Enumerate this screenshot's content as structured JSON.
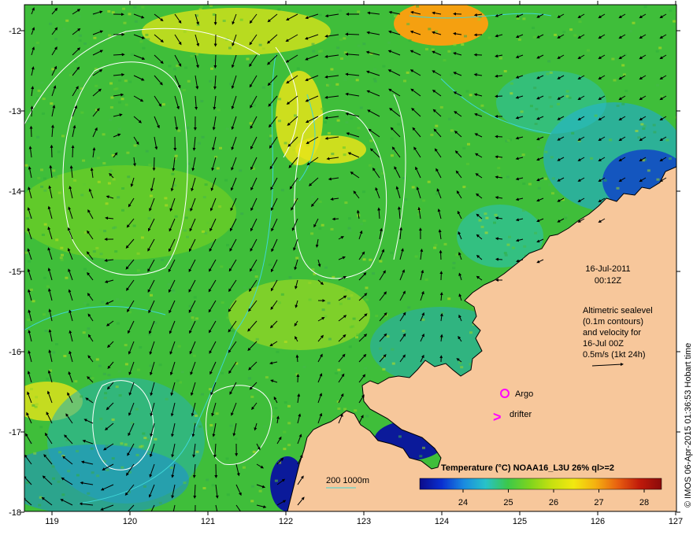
{
  "colors": {
    "land": "#f7c79b",
    "sst_warm": "#e9e417",
    "sst_mid": "#3fbe3a",
    "sst_cool": "#20a8d6",
    "sst_cold": "#0b1a9a",
    "contour": "#ffffff",
    "bathymetry": "#3fd6d6",
    "argo": "#ff00ff",
    "drifter": "#ff00ff"
  },
  "axes": {
    "x_ticks": [
      "119",
      "120",
      "121",
      "122",
      "123",
      "124",
      "125",
      "126",
      "127"
    ],
    "y_ticks": [
      "-12",
      "-13",
      "-14",
      "-15",
      "-16",
      "-17",
      "-18"
    ]
  },
  "annotations": {
    "date": "16-Jul-2011",
    "time": "00:12Z",
    "info_line1": "Altimetric sealevel",
    "info_line2": "(0.1m contours)",
    "info_line3": "and velocity for",
    "info_line4": "16-Jul 00Z",
    "scale_label": "0.5m/s (1kt 24h)",
    "argo_label": "Argo",
    "drifter_label": "drifter",
    "drifter_symbol": ">",
    "bathy_label": "200  1000m",
    "credit": "© IMOS 06-Apr-2015 01:36:53 Hobart time"
  },
  "legend": {
    "title": "Temperature (°C) NOAA16_L3U 26% ql>=2",
    "ticks": [
      "24",
      "25",
      "26",
      "27",
      "28"
    ],
    "colormap": [
      "#0b0b8a",
      "#0a2fd0",
      "#1a8ae0",
      "#28c2c8",
      "#3cc84a",
      "#7dd41e",
      "#c6e010",
      "#f2e810",
      "#f5b010",
      "#e86010",
      "#c01a0a",
      "#8a0a0a"
    ]
  }
}
